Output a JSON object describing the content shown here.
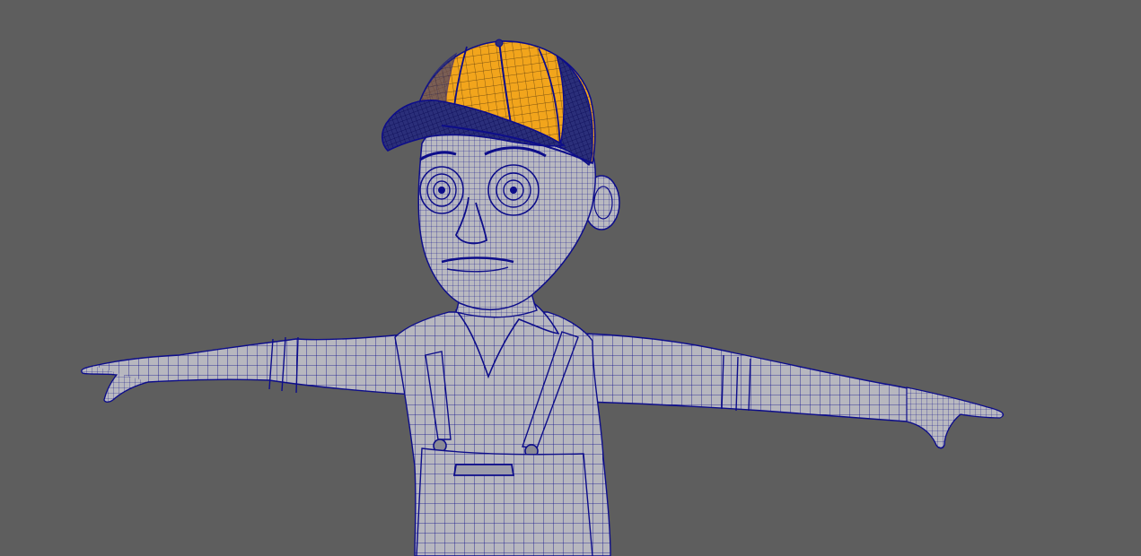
{
  "viewport": {
    "background": "#5e5e5e",
    "wire_color": "#0d0d8a",
    "selection_color": "#f2a51c",
    "model": "t-pose-character-wireframe",
    "selected_object": "baseball-cap",
    "icons": {
      "model": "character-mesh-icon"
    }
  }
}
